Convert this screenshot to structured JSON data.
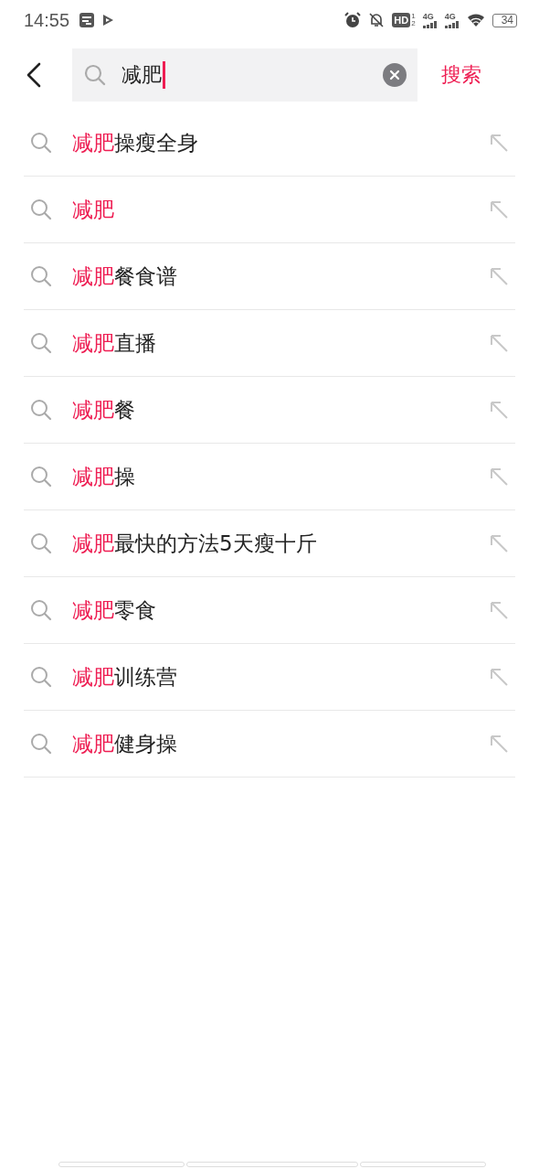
{
  "status_bar": {
    "time": "14:55",
    "hd": "HD",
    "hd_sims": [
      "1",
      "2"
    ],
    "networks": [
      "4G",
      "4G"
    ],
    "battery": "34"
  },
  "search": {
    "value": "减肥",
    "action": "搜索"
  },
  "suggestions": [
    {
      "match": "减肥",
      "rest": "操瘦全身"
    },
    {
      "match": "减肥"
    },
    {
      "match": "减肥",
      "rest": "餐食谱"
    },
    {
      "match": "减肥",
      "rest": "直播"
    },
    {
      "match": "减肥",
      "rest": "餐"
    },
    {
      "match": "减肥",
      "rest": "操"
    },
    {
      "match": "减肥",
      "rest": "最快的方法5天瘦十斤"
    },
    {
      "match": "减肥",
      "rest": "零食"
    },
    {
      "match": "减肥",
      "rest": "训练营"
    },
    {
      "match": "减肥",
      "rest": "健身操"
    }
  ]
}
